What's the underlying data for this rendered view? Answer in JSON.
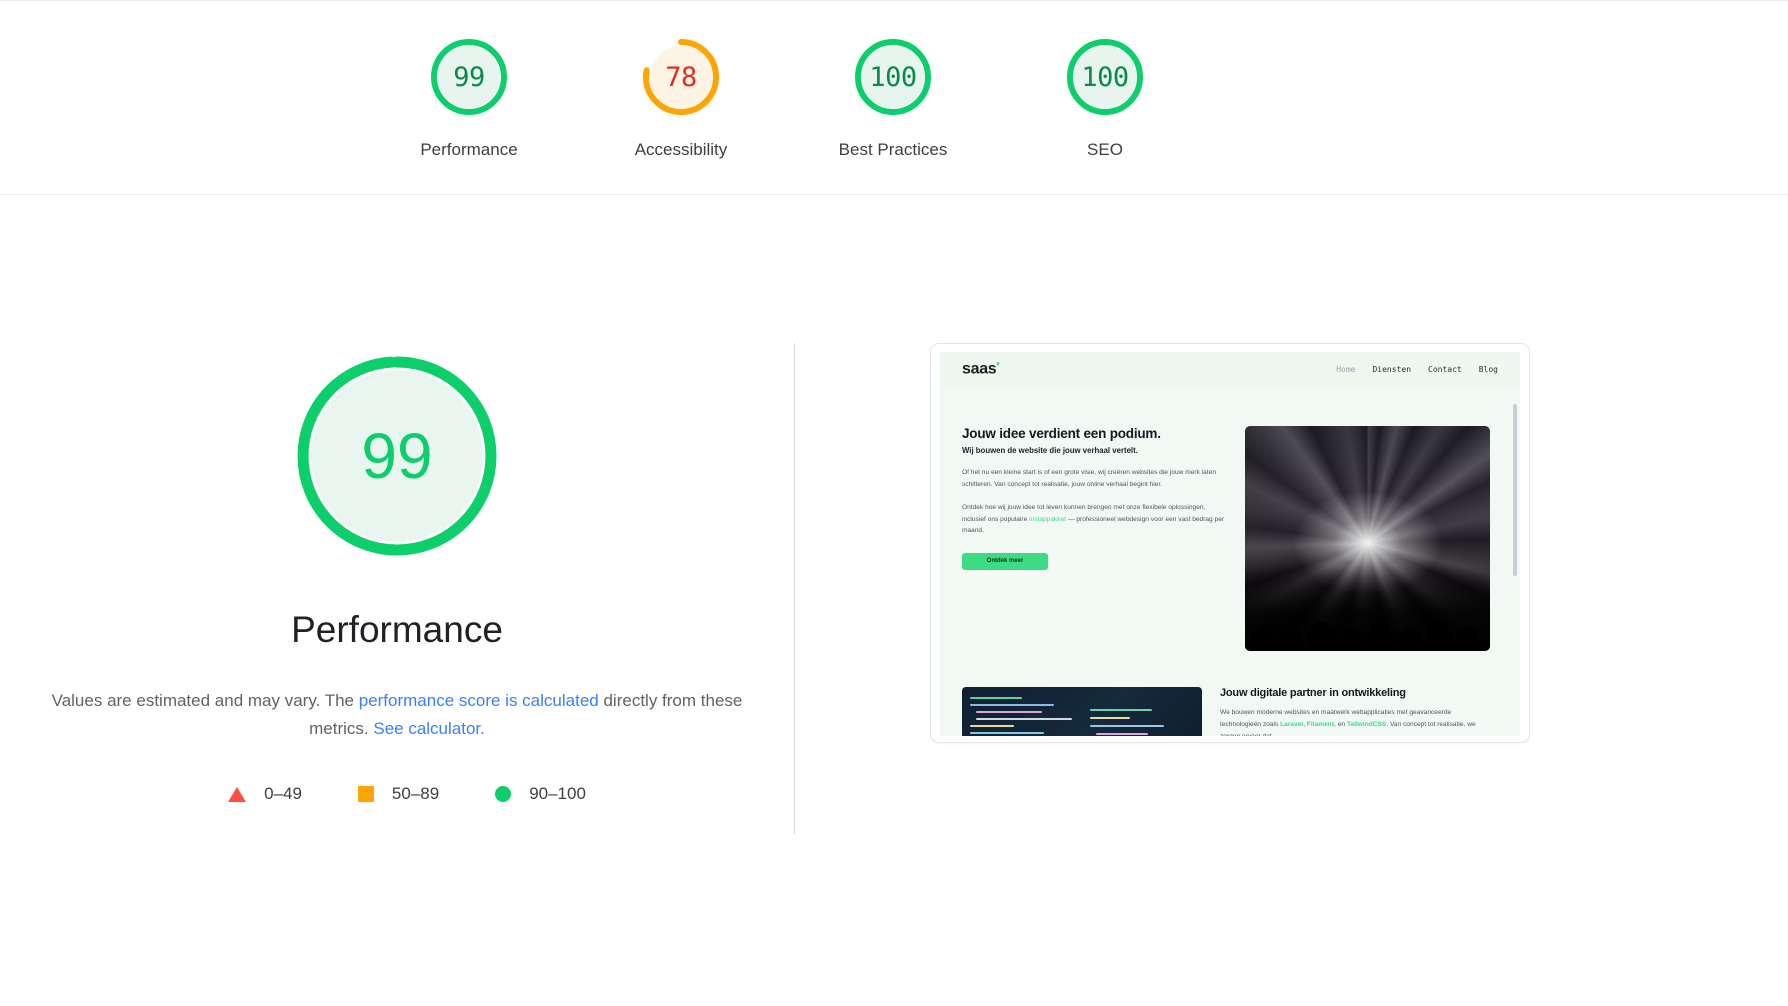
{
  "summary": {
    "gauges": [
      {
        "score": "99",
        "label": "Performance",
        "color": "#0cce6b",
        "bg": "#e8f5ee",
        "pct": 99
      },
      {
        "score": "78",
        "label": "Accessibility",
        "color": "#ffa400",
        "bg": "#fef4e6",
        "bg_text": "#d93025",
        "pct": 78
      },
      {
        "score": "100",
        "label": "Best Practices",
        "color": "#0cce6b",
        "bg": "#e8f5ee",
        "pct": 100
      },
      {
        "score": "100",
        "label": "SEO",
        "color": "#0cce6b",
        "bg": "#e8f5ee",
        "pct": 100
      }
    ]
  },
  "category": {
    "score": "99",
    "title": "Performance",
    "desc_part1": "Values are estimated and may vary. The ",
    "desc_link1": "performance score is calculated",
    "desc_part2": " directly from these metrics. ",
    "desc_link2": "See calculator.",
    "accent_green": "#0cce6b",
    "accent_orange": "#ffa400",
    "accent_red": "#ff4e42",
    "link_color": "#3b7ff5"
  },
  "legend": [
    {
      "marker": "triangle-icon",
      "label": "0–49"
    },
    {
      "marker": "square-icon",
      "label": "50–89"
    },
    {
      "marker": "circle-icon",
      "label": "90–100"
    }
  ],
  "screenshot": {
    "logo": "saas",
    "logo_sup": "•",
    "nav": [
      {
        "label": "Home",
        "dim": true
      },
      {
        "label": "Diensten",
        "dim": false
      },
      {
        "label": "Contact",
        "dim": false
      },
      {
        "label": "Blog",
        "dim": false
      }
    ],
    "hero": {
      "heading": "Jouw idee verdient een podium.",
      "subheading": "Wij bouwen de website die jouw verhaal vertelt.",
      "paragraph1": "Of het nu een kleine start is of een grote visie, wij creëren websites die jouw merk laten schitteren. Van concept tot realisatie, jouw online verhaal begint hier.",
      "paragraph2_a": "Ontdek hoe wij jouw idee tot leven kunnen brengen met onze flexibele oplossingen, inclusief ons populaire ",
      "paragraph2_link": "instappakket",
      "paragraph2_b": " — professioneel webdesign voor een vast bedrag per maand.",
      "button": "Ontdek meer"
    },
    "band2": {
      "heading": "Jouw digitale partner in ontwikkeling",
      "text_a": "We bouwen moderne websites en maatwerk webapplicaties met geavanceerde technologieën zoals ",
      "link1": "Laravel",
      "sep1": ", ",
      "link2": "Filament",
      "sep2": ", en ",
      "link3": "TailwindCSS",
      "text_b": ". Van concept tot realisatie, we zorgen ervoor dat"
    }
  }
}
